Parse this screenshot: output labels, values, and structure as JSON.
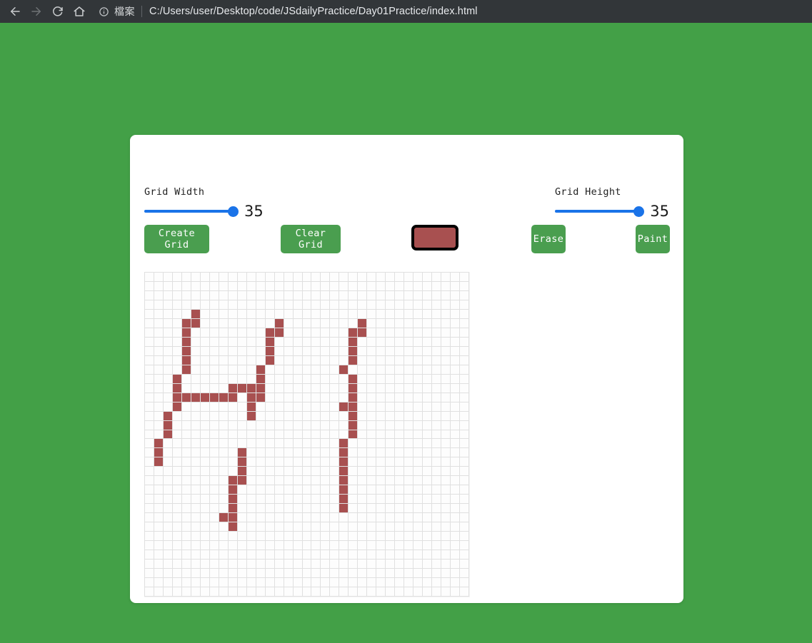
{
  "browser": {
    "back_icon": "arrow-left-icon",
    "forward_icon": "arrow-right-icon",
    "reload_icon": "reload-icon",
    "home_icon": "home-icon",
    "site_info_icon": "info-circle-icon",
    "scheme_label": "檔案",
    "url": "C:/Users/user/Desktop/code/JSdailyPractice/Day01Practice/index.html"
  },
  "page": {
    "background_color": "#43a047",
    "card_background": "#ffffff"
  },
  "controls": {
    "width_slider": {
      "label": "Grid Width",
      "value": "35",
      "min": "1",
      "max": "35",
      "accent_color": "#1a73e8"
    },
    "height_slider": {
      "label": "Grid Height",
      "value": "35",
      "min": "1",
      "max": "35",
      "accent_color": "#1a73e8"
    },
    "create_grid_label": "Create Grid",
    "clear_grid_label": "Clear Grid",
    "erase_label": "Erase",
    "paint_label": "Paint",
    "button_color": "#4a9e4f",
    "color_picker": {
      "name": "color-swatch",
      "value": "#a85050"
    }
  },
  "grid": {
    "columns": 35,
    "rows": 35,
    "cell_color": "#fdfdfd",
    "line_color": "#e0e0e0",
    "paint_color": "#a85050",
    "filled_cells": [
      [
        4,
        5
      ],
      [
        5,
        4
      ],
      [
        5,
        5
      ],
      [
        5,
        14
      ],
      [
        5,
        23
      ],
      [
        6,
        4
      ],
      [
        6,
        13
      ],
      [
        6,
        14
      ],
      [
        6,
        22
      ],
      [
        6,
        23
      ],
      [
        7,
        4
      ],
      [
        7,
        13
      ],
      [
        7,
        22
      ],
      [
        8,
        4
      ],
      [
        8,
        13
      ],
      [
        8,
        22
      ],
      [
        9,
        4
      ],
      [
        9,
        13
      ],
      [
        9,
        22
      ],
      [
        10,
        4
      ],
      [
        10,
        12
      ],
      [
        10,
        21
      ],
      [
        11,
        3
      ],
      [
        11,
        12
      ],
      [
        11,
        22
      ],
      [
        12,
        3
      ],
      [
        12,
        9
      ],
      [
        12,
        10
      ],
      [
        12,
        11
      ],
      [
        12,
        12
      ],
      [
        12,
        22
      ],
      [
        13,
        3
      ],
      [
        13,
        4
      ],
      [
        13,
        5
      ],
      [
        13,
        6
      ],
      [
        13,
        7
      ],
      [
        13,
        8
      ],
      [
        13,
        9
      ],
      [
        13,
        11
      ],
      [
        13,
        12
      ],
      [
        13,
        22
      ],
      [
        14,
        3
      ],
      [
        14,
        11
      ],
      [
        14,
        21
      ],
      [
        14,
        22
      ],
      [
        15,
        2
      ],
      [
        15,
        11
      ],
      [
        15,
        22
      ],
      [
        16,
        2
      ],
      [
        16,
        22
      ],
      [
        17,
        2
      ],
      [
        17,
        22
      ],
      [
        18,
        1
      ],
      [
        18,
        21
      ],
      [
        19,
        1
      ],
      [
        19,
        10
      ],
      [
        19,
        21
      ],
      [
        20,
        1
      ],
      [
        20,
        10
      ],
      [
        20,
        21
      ],
      [
        21,
        10
      ],
      [
        21,
        21
      ],
      [
        22,
        9
      ],
      [
        22,
        10
      ],
      [
        22,
        21
      ],
      [
        23,
        9
      ],
      [
        23,
        21
      ],
      [
        24,
        9
      ],
      [
        24,
        21
      ],
      [
        25,
        9
      ],
      [
        25,
        21
      ],
      [
        26,
        8
      ],
      [
        26,
        9
      ],
      [
        27,
        9
      ]
    ]
  }
}
